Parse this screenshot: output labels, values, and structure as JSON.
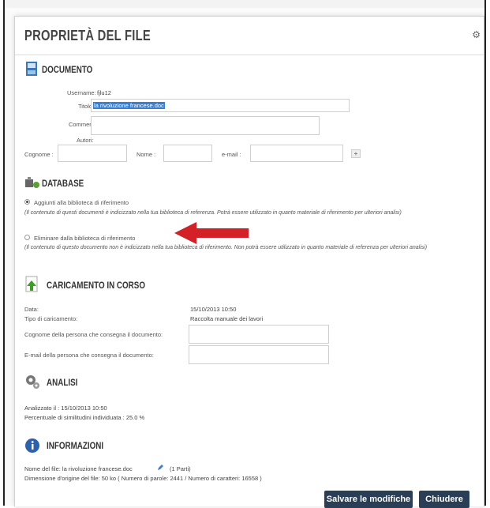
{
  "dialog": {
    "title": "PROPRIETÀ DEL FILE",
    "close": "⚙"
  },
  "documento": {
    "heading": "DOCUMENTO",
    "username_label": "Username:",
    "username_value": "fjlu12",
    "titolo_label": "Titolo:",
    "titolo_value": "la rivoluzione francese.doc",
    "commenti_label": "Commenti:",
    "autori_label": "Autori:",
    "cognome_label": "Cognome :",
    "nome_label": "Nome :",
    "email_label": "e-mail :",
    "add_label": "+"
  },
  "database": {
    "heading": "DATABASE",
    "option1": "Aggiunti alla biblioteca di riferimento",
    "note1": "(Il contenuto di questi documenti è indicizzato nella tua biblioteca di referenza. Potrà essere utilizzato in quanto materiale di riferimento per ulteriori analisi)",
    "option2": "Eliminare dalla biblioteca di riferimento",
    "note2": "(Il contenuto di questo documento non è indicizzato nella tua biblioteca di riferimento. Non potrà essere utilizzato in quanto materiale di referenza per ulteriori analisi)",
    "selected": 1
  },
  "caricamento": {
    "heading": "CARICAMENTO IN CORSO",
    "data_label": "Data:",
    "data_value": "15/10/2013 10:50",
    "tipo_label": "Tipo di caricamento:",
    "tipo_value": "Raccolta manuale dei lavori",
    "cognome_label": "Cognome della persona che consegna il documento:",
    "email_label": "E-mail della persona che consegna il documento:"
  },
  "analisi": {
    "heading": "ANALISI",
    "line1": "Analizzato il : 15/10/2013 10:50",
    "line2": "Percentuale di similitudini individuata : 25.0 %"
  },
  "informazioni": {
    "heading": "INFORMAZIONI",
    "line1a": "Nome del file: la rivoluzione francese.doc",
    "line1b": "(1 Parti)",
    "line2": "Dimensione d'origine del file: 50 ko ( Numero di parole: 2441 / Numero di caratteri: 16558 )"
  },
  "buttons": {
    "save": "Salvare le modifiche",
    "close": "Chiudere"
  },
  "colors": {
    "arrow": "#d42127",
    "button": "#2a3f55",
    "selection": "#3b7fd1"
  }
}
